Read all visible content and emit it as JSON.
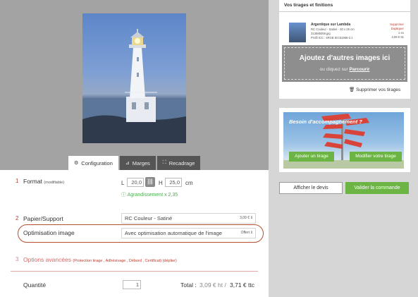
{
  "tabs": [
    {
      "label": "Configuration",
      "icon": "gear-icon"
    },
    {
      "label": "Marges",
      "icon": "margins-icon"
    },
    {
      "label": "Recadrage",
      "icon": "crop-icon"
    }
  ],
  "format": {
    "num": "1",
    "label": "Format",
    "note": "(modifiable)",
    "l_label": "L",
    "l_value": "20,0",
    "h_label": "H",
    "h_value": "25,0",
    "unit": "cm",
    "enlargement": "Agrandissement x 2,35"
  },
  "paper": {
    "num": "2",
    "label": "Papier/Support",
    "value": "RC Couleur - Satiné",
    "price": "3,09 €"
  },
  "optim": {
    "label": "Optimisation image",
    "value": "Avec optimisation automatique de l'image",
    "price": "Offert"
  },
  "options": {
    "num": "3",
    "label": "Options avancées",
    "sub": "(Protection tirage , Adhésivage , Débord , Certificat) (déplier)"
  },
  "quantity": {
    "label": "Quantité",
    "value": "1",
    "total_label": "Total :",
    "ht": "3,09 € ht /",
    "ttc": "3,71 € ttc"
  },
  "cart": {
    "tab": "Vos tirages et finitions",
    "title": "Argentique sur Lambda",
    "line1": "RC Couleur - Satiné - 20 x 25 cm",
    "line2": "313585059.jpg",
    "line3": "Profil ICC : sRGB IEC61966-2.1",
    "delete": "Supprimer",
    "duplicate": "Dupliquer",
    "qty": "1 ex",
    "price": "3,09 € ttc",
    "drop_title": "Ajoutez d'autres images ici",
    "drop_sub": "ou cliquez sur",
    "drop_link": "Parcourir",
    "remove_all": "Supprimer vos tirages"
  },
  "promo": {
    "title": "Besoin d'accompagnement ?",
    "btn1": "Ajouter un tirage",
    "btn2": "Modifier votre tirage"
  },
  "actions": {
    "devis": "Afficher le devis",
    "valider": "Valider la commande"
  },
  "colors": {
    "accent_red": "#c0392b",
    "green": "#6cb544",
    "grey_bg": "#d6d6d6"
  }
}
